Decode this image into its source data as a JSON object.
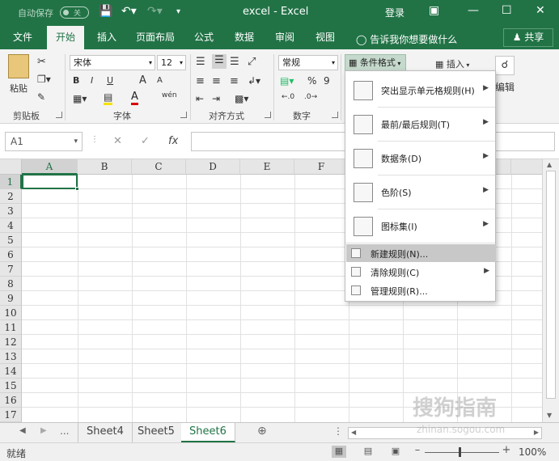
{
  "titlebar": {
    "autosave": "自动保存",
    "autosave_state": "关",
    "title": "excel  -  Excel",
    "login": "登录"
  },
  "tabs": [
    "文件",
    "开始",
    "插入",
    "页面布局",
    "公式",
    "数据",
    "审阅",
    "视图"
  ],
  "tell_me": "告诉我你想要做什么",
  "share": "共享",
  "ribbon": {
    "paste": "粘贴",
    "clipboard": "剪贴板",
    "font_name": "宋体",
    "font_size": "12",
    "font_group": "字体",
    "align_group": "对齐方式",
    "number_format": "常规",
    "number_group": "数字",
    "conditional_format": "条件格式",
    "insert": "插入",
    "edit": "编辑",
    "bold": "B",
    "italic": "I",
    "underline": "U",
    "grow": "A",
    "shrink": "A",
    "wen": "wén",
    "percent": "%",
    "comma": "9"
  },
  "formula": {
    "namebox": "A1",
    "fx": "fx",
    "value": ""
  },
  "columns": [
    "A",
    "B",
    "C",
    "D",
    "E",
    "F"
  ],
  "rows": [
    "1",
    "2",
    "3",
    "4",
    "5",
    "6",
    "7",
    "8",
    "9",
    "10",
    "11",
    "12",
    "13",
    "14",
    "15",
    "16",
    "17"
  ],
  "menu": {
    "items_big": [
      {
        "label": "突出显示单元格规则(H)"
      },
      {
        "label": "最前/最后规则(T)"
      },
      {
        "label": "数据条(D)"
      },
      {
        "label": "色阶(S)"
      },
      {
        "label": "图标集(I)"
      }
    ],
    "items_small": [
      {
        "label": "新建规则(N)..."
      },
      {
        "label": "清除规则(C)"
      },
      {
        "label": "管理规则(R)..."
      }
    ]
  },
  "sheets": [
    "Sheet4",
    "Sheet5",
    "Sheet6"
  ],
  "sheet_ellipsis": "...",
  "status": {
    "ready": "就绪",
    "zoom": "100%"
  },
  "watermark": "搜狗指南",
  "watermark_url": "zhinan.sogou.com"
}
